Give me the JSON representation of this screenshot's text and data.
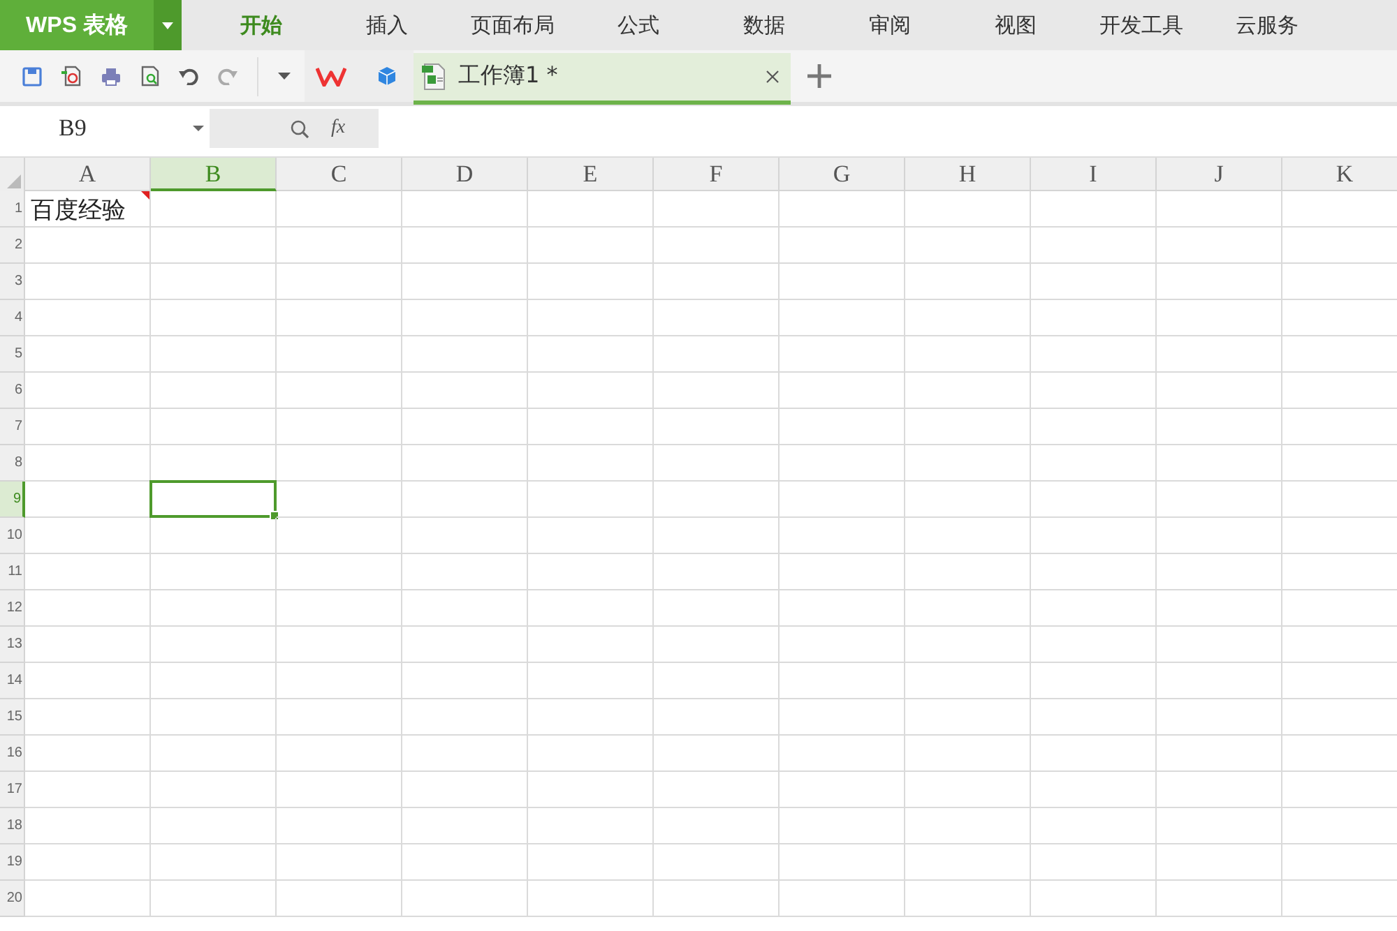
{
  "app": {
    "title": "WPS 表格"
  },
  "menu_tabs": [
    {
      "label": "开始",
      "selected": true
    },
    {
      "label": "插入",
      "selected": false
    },
    {
      "label": "页面布局",
      "selected": false
    },
    {
      "label": "公式",
      "selected": false
    },
    {
      "label": "数据",
      "selected": false
    },
    {
      "label": "审阅",
      "selected": false
    },
    {
      "label": "视图",
      "selected": false
    },
    {
      "label": "开发工具",
      "selected": false
    },
    {
      "label": "云服务",
      "selected": false
    }
  ],
  "document_tab": {
    "title": "工作簿1 *",
    "selected": true
  },
  "formula_bar": {
    "name_box": "B9",
    "fx": "fx"
  },
  "columns": [
    {
      "label": "A",
      "selected": false
    },
    {
      "label": "B",
      "selected": true
    },
    {
      "label": "C",
      "selected": false
    },
    {
      "label": "D",
      "selected": false
    },
    {
      "label": "E",
      "selected": false
    },
    {
      "label": "F",
      "selected": false
    },
    {
      "label": "G",
      "selected": false
    },
    {
      "label": "H",
      "selected": false
    },
    {
      "label": "I",
      "selected": false
    },
    {
      "label": "J",
      "selected": false
    },
    {
      "label": "K",
      "selected": false
    }
  ],
  "rows": [
    {
      "number": "1",
      "selected": false,
      "cells": [
        {
          "text": "百度经验",
          "comment": true
        }
      ]
    },
    {
      "number": "2",
      "selected": false
    },
    {
      "number": "3",
      "selected": false
    },
    {
      "number": "4",
      "selected": false
    },
    {
      "number": "5",
      "selected": false
    },
    {
      "number": "6",
      "selected": false
    },
    {
      "number": "7",
      "selected": false
    },
    {
      "number": "8",
      "selected": false
    },
    {
      "number": "9",
      "selected": true
    },
    {
      "number": "10",
      "selected": false
    },
    {
      "number": "11",
      "selected": false
    },
    {
      "number": "12",
      "selected": false
    },
    {
      "number": "13",
      "selected": false
    },
    {
      "number": "14",
      "selected": false
    },
    {
      "number": "15",
      "selected": false
    },
    {
      "number": "16",
      "selected": false
    },
    {
      "number": "17",
      "selected": false
    },
    {
      "number": "18",
      "selected": false
    },
    {
      "number": "19",
      "selected": false
    },
    {
      "number": "20",
      "selected": false
    }
  ]
}
